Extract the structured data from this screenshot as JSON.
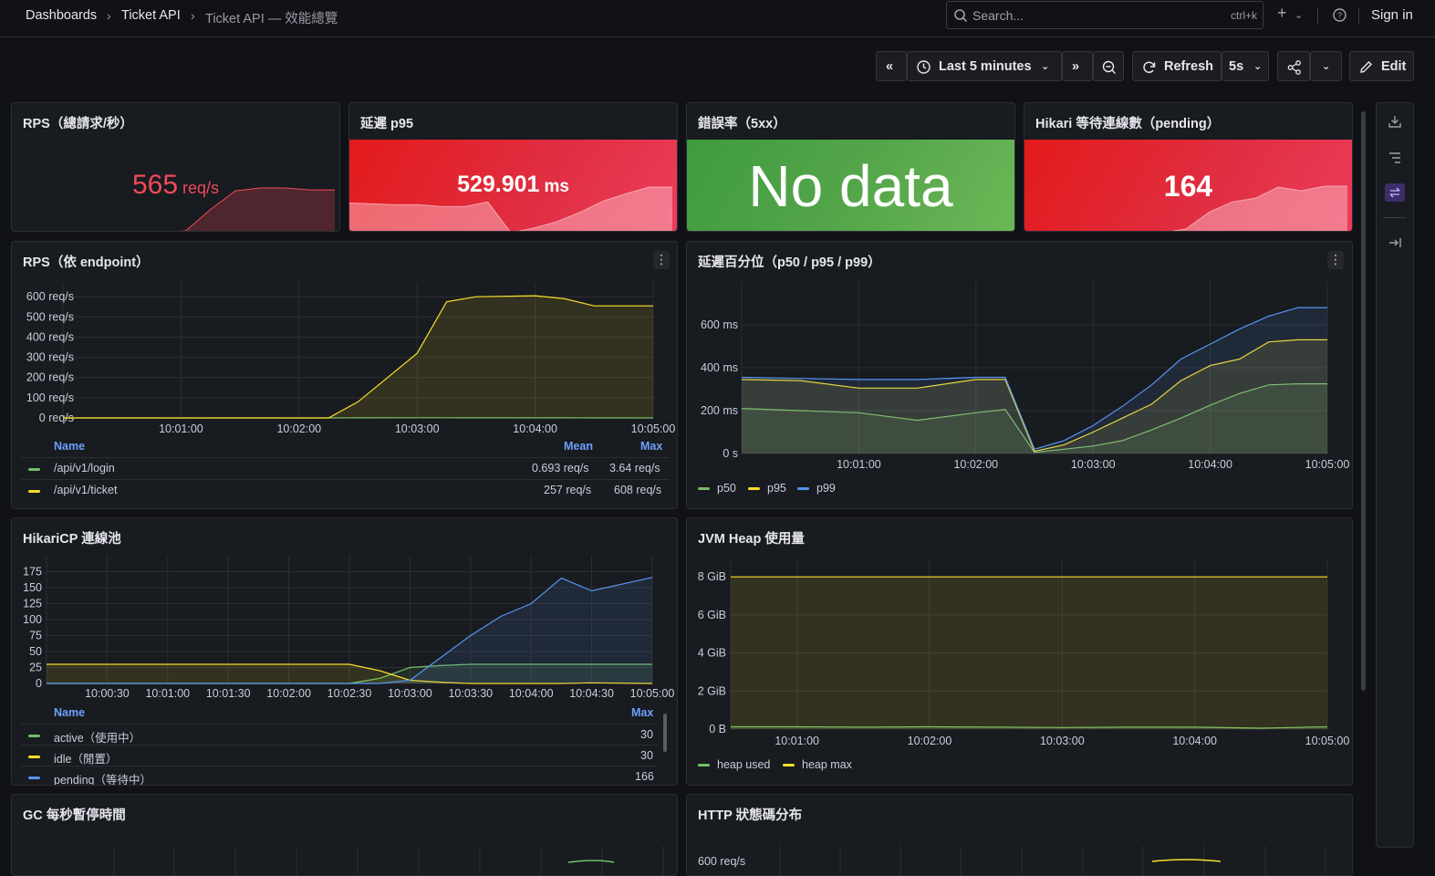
{
  "breadcrumb": {
    "root": "Dashboards",
    "folder": "Ticket API",
    "current": "Ticket API — 效能總覽"
  },
  "search": {
    "placeholder": "Search...",
    "shortcut": "ctrl+k"
  },
  "topbar": {
    "add_icon": "plus-icon",
    "help_icon": "help-circle-icon",
    "sign_in": "Sign in"
  },
  "toolbar": {
    "time_range": "Last 5 minutes",
    "refresh": "Refresh",
    "refresh_interval": "5s",
    "edit": "Edit",
    "icons": [
      "chevrons-left-icon",
      "clock-icon",
      "chevrons-right-icon",
      "zoom-out-icon",
      "refresh-icon",
      "share-icon",
      "chevron-down-icon",
      "pencil-icon"
    ]
  },
  "colors": {
    "green": "#73bf69",
    "yellow": "#fade2a",
    "blue": "#5794f2",
    "red": "#e02f44",
    "stat_green": "#56a64b"
  },
  "stats": [
    {
      "title": "RPS（總請求/秒）",
      "value": "565",
      "unit": "req/s",
      "color": "#f2495c",
      "spark": [
        0,
        0,
        0,
        0,
        0,
        0,
        0,
        0.02,
        0.25,
        0.45,
        0.48,
        0.48,
        0.46,
        0.46
      ]
    },
    {
      "title": "延遲 p95",
      "value": "529.901",
      "unit": "ms",
      "color": "#e02f44",
      "spark": [
        0.32,
        0.31,
        0.3,
        0.3,
        0.28,
        0.28,
        0.33,
        0,
        0.05,
        0.12,
        0.22,
        0.34,
        0.42,
        0.49,
        0.49
      ]
    },
    {
      "title": "錯誤率（5xx）",
      "value": "No data",
      "unit": "",
      "color": "#56a64b"
    },
    {
      "title": "Hikari 等待連線數（pending）",
      "value": "164",
      "unit": "",
      "color": "#e02f44",
      "spark": [
        0,
        0,
        0,
        0,
        0,
        0,
        0,
        0.04,
        0.22,
        0.33,
        0.37,
        0.49,
        0.45,
        0.5,
        0.5
      ]
    }
  ],
  "panels": {
    "rps_endpoint": {
      "title": "RPS（依 endpoint）",
      "table": {
        "headers": [
          "Name",
          "Mean",
          "Max"
        ],
        "rows": [
          {
            "name": "/api/v1/login",
            "mean": "0.693 req/s",
            "max": "3.64 req/s"
          },
          {
            "name": "/api/v1/ticket",
            "mean": "257 req/s",
            "max": "608 req/s"
          }
        ]
      }
    },
    "latency": {
      "title": "延遲百分位（p50 / p95 / p99）",
      "legend": [
        "p50",
        "p95",
        "p99"
      ]
    },
    "hikari": {
      "title": "HikariCP 連線池",
      "table": {
        "headers": [
          "Name",
          "Max"
        ],
        "rows": [
          {
            "name": "active（使用中）",
            "max": "30"
          },
          {
            "name": "idle（閒置）",
            "max": "30"
          },
          {
            "name": "pending（等待中）",
            "max": "166"
          }
        ]
      }
    },
    "heap": {
      "title": "JVM Heap 使用量",
      "legend": [
        "heap used",
        "heap max"
      ]
    },
    "gc": {
      "title": "GC 每秒暫停時間"
    },
    "http": {
      "title": "HTTP 狀態碼分布",
      "y_top_label": "600 req/s"
    }
  },
  "chart_data": [
    {
      "type": "line",
      "title": "RPS（依 endpoint）",
      "x": [
        "10:00:00",
        "10:00:30",
        "10:01:00",
        "10:01:30",
        "10:02:00",
        "10:02:15",
        "10:02:30",
        "10:03:00",
        "10:03:15",
        "10:03:30",
        "10:04:00",
        "10:04:15",
        "10:04:30",
        "10:05:00"
      ],
      "x_ticks": [
        "10:01:00",
        "10:02:00",
        "10:03:00",
        "10:04:00",
        "10:05:00"
      ],
      "y_ticks": [
        "0 req/s",
        "100 req/s",
        "200 req/s",
        "300 req/s",
        "400 req/s",
        "500 req/s",
        "600 req/s"
      ],
      "ylim": [
        0,
        610
      ],
      "series": [
        {
          "name": "/api/v1/login",
          "values": [
            0,
            0,
            0,
            0,
            0,
            0,
            0.5,
            1,
            0.8,
            0.5,
            0.5,
            0.3,
            0.2,
            0.2
          ]
        },
        {
          "name": "/api/v1/ticket",
          "values": [
            0,
            0,
            0,
            0,
            0,
            0,
            80,
            320,
            575,
            600,
            605,
            590,
            555,
            555
          ]
        }
      ]
    },
    {
      "type": "line",
      "title": "延遲百分位（p50 / p95 / p99）",
      "x": [
        "10:00:00",
        "10:00:30",
        "10:01:00",
        "10:01:30",
        "10:02:00",
        "10:02:15",
        "10:02:30",
        "10:02:45",
        "10:03:00",
        "10:03:15",
        "10:03:30",
        "10:03:45",
        "10:04:00",
        "10:04:15",
        "10:04:30",
        "10:04:45",
        "10:05:00"
      ],
      "x_ticks": [
        "10:01:00",
        "10:02:00",
        "10:03:00",
        "10:04:00",
        "10:05:00"
      ],
      "y_ticks": [
        "0 s",
        "200 ms",
        "400 ms",
        "600 ms"
      ],
      "ylim": [
        0,
        740
      ],
      "series": [
        {
          "name": "p50",
          "values": [
            210,
            200,
            190,
            155,
            190,
            205,
            5,
            20,
            35,
            60,
            110,
            165,
            225,
            280,
            320,
            325,
            325
          ]
        },
        {
          "name": "p95",
          "values": [
            345,
            340,
            305,
            305,
            345,
            345,
            10,
            40,
            100,
            165,
            230,
            340,
            410,
            440,
            520,
            530,
            530
          ]
        },
        {
          "name": "p99",
          "values": [
            355,
            350,
            345,
            345,
            355,
            355,
            20,
            60,
            130,
            220,
            320,
            440,
            510,
            580,
            640,
            680,
            680
          ]
        }
      ]
    },
    {
      "type": "line",
      "title": "HikariCP 連線池",
      "x": [
        "10:00:00",
        "10:00:30",
        "10:01:00",
        "10:01:30",
        "10:02:00",
        "10:02:30",
        "10:02:45",
        "10:03:00",
        "10:03:15",
        "10:03:30",
        "10:03:45",
        "10:04:00",
        "10:04:15",
        "10:04:30",
        "10:05:00"
      ],
      "x_ticks": [
        "10:00:30",
        "10:01:00",
        "10:01:30",
        "10:02:00",
        "10:02:30",
        "10:03:00",
        "10:03:30",
        "10:04:00",
        "10:04:30",
        "10:05:00"
      ],
      "y_ticks": [
        "0",
        "25",
        "50",
        "75",
        "100",
        "125",
        "150",
        "175"
      ],
      "ylim": [
        0,
        180
      ],
      "series": [
        {
          "name": "active（使用中）",
          "values": [
            0,
            0,
            0,
            0,
            0,
            0,
            8,
            25,
            28,
            30,
            30,
            30,
            30,
            30,
            30
          ]
        },
        {
          "name": "idle（閒置）",
          "values": [
            30,
            30,
            30,
            30,
            30,
            30,
            20,
            5,
            2,
            0,
            0,
            0,
            0,
            1,
            0
          ]
        },
        {
          "name": "pending（等待中）",
          "values": [
            0,
            0,
            0,
            0,
            0,
            0,
            0,
            5,
            40,
            75,
            105,
            125,
            165,
            145,
            166
          ]
        }
      ]
    },
    {
      "type": "area",
      "title": "JVM Heap 使用量",
      "x": [
        "10:00:30",
        "10:01:00",
        "10:01:30",
        "10:02:00",
        "10:02:30",
        "10:03:00",
        "10:03:30",
        "10:04:00",
        "10:04:30",
        "10:05:00"
      ],
      "x_ticks": [
        "10:01:00",
        "10:02:00",
        "10:03:00",
        "10:04:00",
        "10:05:00"
      ],
      "y_ticks": [
        "0 B",
        "2 GiB",
        "4 GiB",
        "6 GiB",
        "8 GiB"
      ],
      "ylim": [
        0,
        8.2
      ],
      "series": [
        {
          "name": "heap used",
          "values": [
            0.12,
            0.12,
            0.1,
            0.12,
            0.1,
            0.08,
            0.1,
            0.1,
            0.05,
            0.12
          ]
        },
        {
          "name": "heap max",
          "values": [
            8,
            8,
            8,
            8,
            8,
            8,
            8,
            8,
            8,
            8
          ]
        }
      ]
    }
  ]
}
